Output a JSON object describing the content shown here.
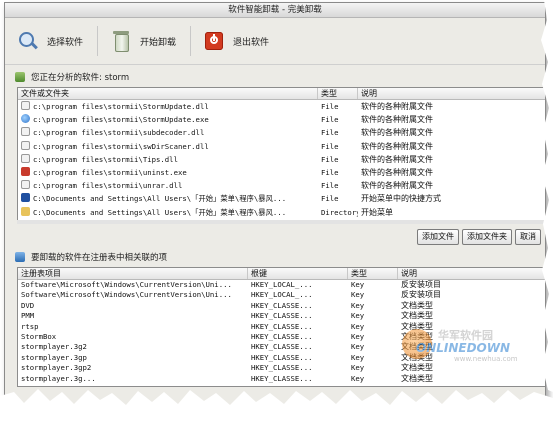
{
  "window": {
    "title": "软件智能卸载 - 完美卸载"
  },
  "toolbar": {
    "select_label": "选择软件",
    "start_label": "开始卸载",
    "exit_label": "退出软件"
  },
  "files_section": {
    "title": "您正在分析的软件: storm",
    "columns": [
      "文件或文件夹",
      "类型",
      "说明"
    ],
    "rows": [
      {
        "icon": "dll-file-icon",
        "path": "c:\\program files\\stormii\\StormUpdate.dll",
        "type": "File",
        "desc": "软件的各种附属文件"
      },
      {
        "icon": "exe-file-icon",
        "path": "c:\\program files\\stormii\\StormUpdate.exe",
        "type": "File",
        "desc": "软件的各种附属文件"
      },
      {
        "icon": "dll-file-icon",
        "path": "c:\\program files\\stormii\\subdecoder.dll",
        "type": "File",
        "desc": "软件的各种附属文件"
      },
      {
        "icon": "dll-file-icon",
        "path": "c:\\program files\\stormii\\swDirScaner.dll",
        "type": "File",
        "desc": "软件的各种附属文件"
      },
      {
        "icon": "dll-file-icon",
        "path": "c:\\program files\\stormii\\Tips.dll",
        "type": "File",
        "desc": "软件的各种附属文件"
      },
      {
        "icon": "uninstall-exe-icon",
        "path": "c:\\program files\\stormii\\uninst.exe",
        "type": "File",
        "desc": "软件的各种附属文件"
      },
      {
        "icon": "dll-file-icon",
        "path": "c:\\program files\\stormii\\unrar.dll",
        "type": "File",
        "desc": "软件的各种附属文件"
      },
      {
        "icon": "shortcut-icon",
        "path": "C:\\Documents and Settings\\All Users\\「开始」菜单\\程序\\暴风...",
        "type": "File",
        "desc": "开始菜单中的快捷方式"
      },
      {
        "icon": "folder-icon",
        "path": "C:\\Documents and Settings\\All Users\\「开始」菜单\\程序\\暴风...",
        "type": "Directory",
        "desc": "开始菜单"
      }
    ]
  },
  "buttons": {
    "add_file": "添加文件",
    "add_folder": "添加文件夹",
    "cancel": "取消"
  },
  "registry_section": {
    "title": "要卸载的软件在注册表中相关联的项",
    "columns": [
      "注册表项目",
      "根键",
      "类型",
      "说明"
    ],
    "rows": [
      {
        "item": "Software\\Microsoft\\Windows\\CurrentVersion\\Uni...",
        "root": "HKEY_LOCAL_...",
        "type": "Key",
        "desc": "反安装项目"
      },
      {
        "item": "Software\\Microsoft\\Windows\\CurrentVersion\\Uni...",
        "root": "HKEY_LOCAL_...",
        "type": "Key",
        "desc": "反安装项目"
      },
      {
        "item": "DVD",
        "root": "HKEY_CLASSE...",
        "type": "Key",
        "desc": "文档类型"
      },
      {
        "item": "PMM",
        "root": "HKEY_CLASSE...",
        "type": "Key",
        "desc": "文档类型"
      },
      {
        "item": "rtsp",
        "root": "HKEY_CLASSE...",
        "type": "Key",
        "desc": "文档类型"
      },
      {
        "item": "StormBox",
        "root": "HKEY_CLASSE...",
        "type": "Key",
        "desc": "文档类型"
      },
      {
        "item": "stormplayer.3g2",
        "root": "HKEY_CLASSE...",
        "type": "Key",
        "desc": "文档类型"
      },
      {
        "item": "stormplayer.3gp",
        "root": "HKEY_CLASSE...",
        "type": "Key",
        "desc": "文档类型"
      },
      {
        "item": "stormplayer.3gp2",
        "root": "HKEY_CLASSE...",
        "type": "Key",
        "desc": "文档类型"
      },
      {
        "item": "stormplayer.3g...",
        "root": "HKEY_CLASSE...",
        "type": "Key",
        "desc": "文档类型"
      }
    ]
  },
  "watermark": {
    "cn": "华军软件园",
    "en": "ONLINEDOWN",
    "url": "www.newhua.com"
  }
}
